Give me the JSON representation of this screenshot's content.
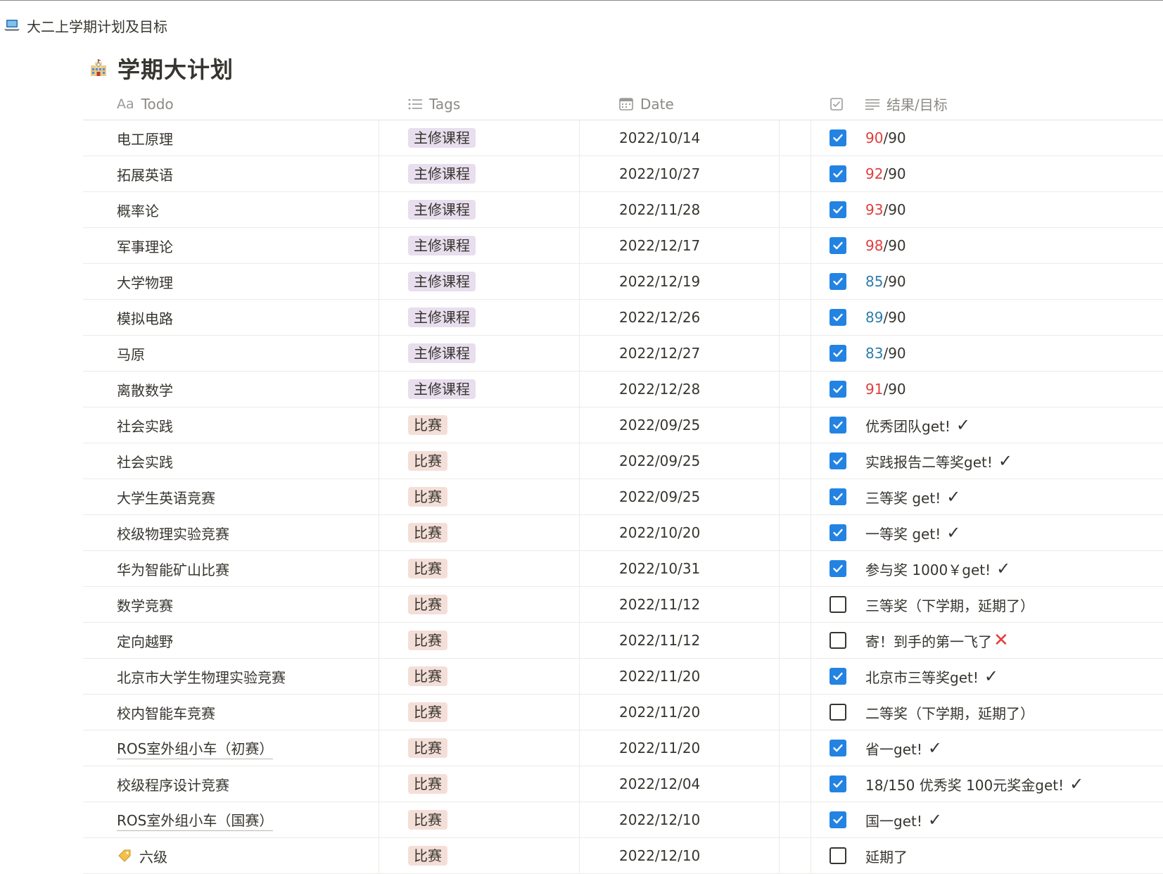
{
  "breadcrumb": {
    "icon": "laptop-icon",
    "label": "大二上学期计划及目标"
  },
  "database": {
    "icon": "school-building-icon",
    "title": "学期大计划"
  },
  "columns": {
    "todo": "Todo",
    "todo_icon_text": "Aa",
    "tags": "Tags",
    "date": "Date",
    "result": "结果/目标"
  },
  "colors": {
    "checkbox_checked": "#2383e2",
    "tag_main_course": "#e8deee",
    "tag_competition": "#f4dfd8",
    "score_above_target": "#e03e3e",
    "score_below_target": "#2e7dab",
    "cross_mark": "#e03e3e"
  },
  "rows": [
    {
      "todo": "电工原理",
      "tag": "主修课程",
      "tag_color": "purple",
      "date": "2022/10/14",
      "checked": true,
      "score": "90",
      "score_color": "red",
      "suffix": "/90"
    },
    {
      "todo": "拓展英语",
      "tag": "主修课程",
      "tag_color": "purple",
      "date": "2022/10/27",
      "checked": true,
      "score": "92",
      "score_color": "red",
      "suffix": "/90"
    },
    {
      "todo": "概率论",
      "tag": "主修课程",
      "tag_color": "purple",
      "date": "2022/11/28",
      "checked": true,
      "score": "93",
      "score_color": "red",
      "suffix": "/90"
    },
    {
      "todo": "军事理论",
      "tag": "主修课程",
      "tag_color": "purple",
      "date": "2022/12/17",
      "checked": true,
      "score": "98",
      "score_color": "red",
      "suffix": "/90"
    },
    {
      "todo": "大学物理",
      "tag": "主修课程",
      "tag_color": "purple",
      "date": "2022/12/19",
      "checked": true,
      "score": "85",
      "score_color": "blue",
      "suffix": "/90"
    },
    {
      "todo": "模拟电路",
      "tag": "主修课程",
      "tag_color": "purple",
      "date": "2022/12/26",
      "checked": true,
      "score": "89",
      "score_color": "blue",
      "suffix": "/90"
    },
    {
      "todo": "马原",
      "tag": "主修课程",
      "tag_color": "purple",
      "date": "2022/12/27",
      "checked": true,
      "score": "83",
      "score_color": "blue",
      "suffix": "/90"
    },
    {
      "todo": "离散数学",
      "tag": "主修课程",
      "tag_color": "purple",
      "date": "2022/12/28",
      "checked": true,
      "score": "91",
      "score_color": "red",
      "suffix": "/90"
    },
    {
      "todo": "社会实践",
      "tag": "比赛",
      "tag_color": "red",
      "date": "2022/09/25",
      "checked": true,
      "result": "优秀团队get!",
      "mark": "✓"
    },
    {
      "todo": "社会实践",
      "tag": "比赛",
      "tag_color": "red",
      "date": "2022/09/25",
      "checked": true,
      "result": "实践报告二等奖get!",
      "mark": "✓"
    },
    {
      "todo": "大学生英语竞赛",
      "tag": "比赛",
      "tag_color": "red",
      "date": "2022/09/25",
      "checked": true,
      "result": "三等奖 get!",
      "mark": "✓"
    },
    {
      "todo": "校级物理实验竞赛",
      "tag": "比赛",
      "tag_color": "red",
      "date": "2022/10/20",
      "checked": true,
      "result": "一等奖 get!",
      "mark": "✓"
    },
    {
      "todo": "华为智能矿山比赛",
      "tag": "比赛",
      "tag_color": "red",
      "date": "2022/10/31",
      "checked": true,
      "result": "参与奖 1000￥get!",
      "mark": "✓"
    },
    {
      "todo": "数学竞赛",
      "tag": "比赛",
      "tag_color": "red",
      "date": "2022/11/12",
      "checked": false,
      "result": "三等奖（下学期，延期了）"
    },
    {
      "todo": "定向越野",
      "tag": "比赛",
      "tag_color": "red",
      "date": "2022/11/12",
      "checked": false,
      "result": "寄！到手的第一飞了",
      "cross": "✕"
    },
    {
      "todo": "北京市大学生物理实验竞赛",
      "tag": "比赛",
      "tag_color": "red",
      "date": "2022/11/20",
      "checked": true,
      "result": "北京市三等奖get!",
      "mark": "✓"
    },
    {
      "todo": "校内智能车竞赛",
      "tag": "比赛",
      "tag_color": "red",
      "date": "2022/11/20",
      "checked": false,
      "result": " 二等奖（下学期，延期了）"
    },
    {
      "todo": "ROS室外组小车（初赛）",
      "tag": "比赛",
      "tag_color": "red",
      "date": "2022/11/20",
      "checked": true,
      "result": "省一get!",
      "mark": "✓",
      "underlined": true
    },
    {
      "todo": "校级程序设计竞赛",
      "tag": "比赛",
      "tag_color": "red",
      "date": "2022/12/04",
      "checked": true,
      "result": "18/150 优秀奖 100元奖金get!",
      "mark": "✓"
    },
    {
      "todo": "ROS室外组小车（国赛）",
      "tag": "比赛",
      "tag_color": "red",
      "date": "2022/12/10",
      "checked": true,
      "result": "国一get!",
      "mark": "✓",
      "underlined": true
    },
    {
      "todo": "六级",
      "page_icon": "label-tag-icon",
      "tag": "比赛",
      "tag_color": "red",
      "date": "2022/12/10",
      "checked": false,
      "result": " 延期了"
    }
  ]
}
